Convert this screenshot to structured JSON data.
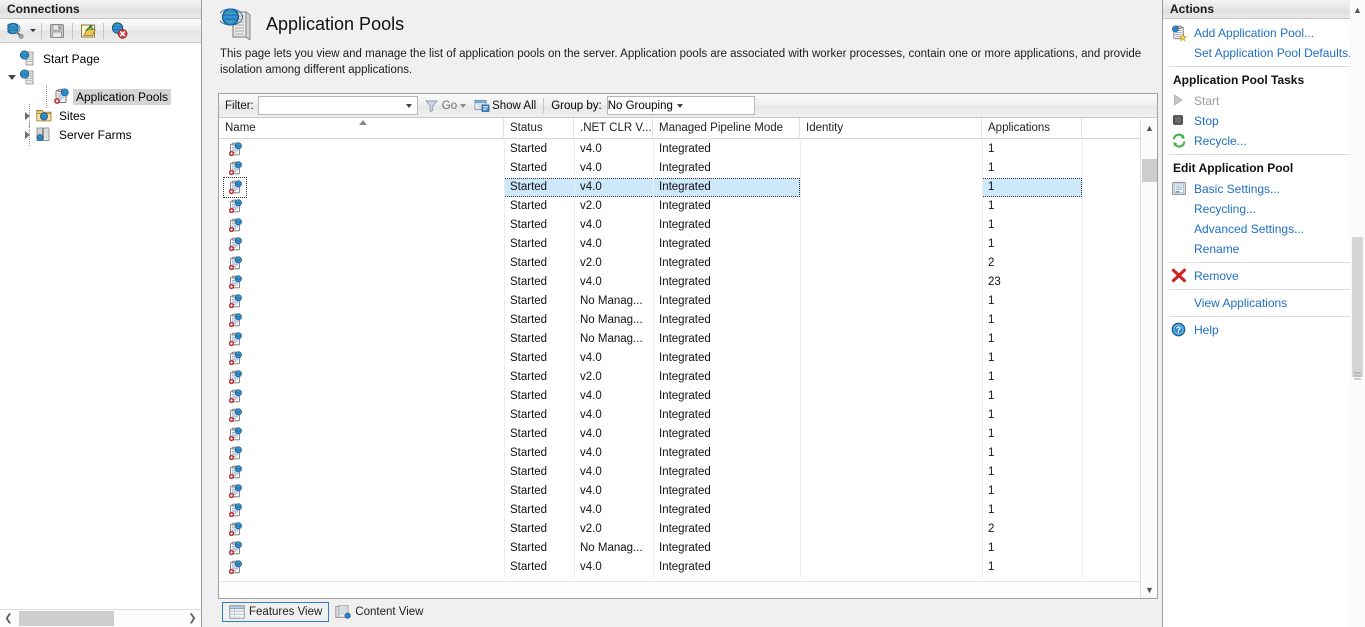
{
  "connections": {
    "title": "Connections",
    "toolbar": [
      {
        "name": "connect-to-button",
        "icon": "globe-connect-icon"
      },
      {
        "name": "save-connections-button",
        "icon": "floppy-disk-icon",
        "disabled": true
      },
      {
        "name": "open-connection-button",
        "icon": "open-folder-icon"
      },
      {
        "name": "disconnect-button",
        "icon": "globe-disconnect-icon"
      }
    ],
    "tree": [
      {
        "label": "Start Page",
        "icon": "start-page-icon",
        "level": 0,
        "expander": "none",
        "selected": false
      },
      {
        "label": "",
        "icon": "server-icon",
        "level": 0,
        "expander": "down",
        "selected": false
      },
      {
        "label": "Application Pools",
        "icon": "application-pools-icon",
        "level": 2,
        "expander": "none",
        "selected": true
      },
      {
        "label": "Sites",
        "icon": "sites-folder-icon",
        "level": 1,
        "expander": "right",
        "selected": false
      },
      {
        "label": "Server Farms",
        "icon": "server-farms-icon",
        "level": 1,
        "expander": "right",
        "selected": false
      }
    ]
  },
  "page": {
    "title": "Application Pools",
    "description": "This page lets you view and manage the list of application pools on the server. Application pools are associated with worker processes, contain one or more applications, and provide isolation among different applications."
  },
  "filter_bar": {
    "filter_label": "Filter:",
    "filter_value": "",
    "go_label": "Go",
    "show_all_label": "Show All",
    "group_by_label": "Group by:",
    "group_by_value": "No Grouping"
  },
  "grid": {
    "columns": [
      {
        "key": "name",
        "label": "Name",
        "sorted": "asc"
      },
      {
        "key": "status",
        "label": "Status"
      },
      {
        "key": "clr",
        "label": ".NET CLR V..."
      },
      {
        "key": "pipeline",
        "label": "Managed Pipeline Mode"
      },
      {
        "key": "identity",
        "label": "Identity"
      },
      {
        "key": "applications",
        "label": "Applications"
      }
    ],
    "rows": [
      {
        "name": "",
        "status": "Started",
        "clr": "v4.0",
        "pipeline": "Integrated",
        "identity": "",
        "applications": "1",
        "selected": false
      },
      {
        "name": "",
        "status": "Started",
        "clr": "v4.0",
        "pipeline": "Integrated",
        "identity": "",
        "applications": "1",
        "selected": false
      },
      {
        "name": "",
        "status": "Started",
        "clr": "v4.0",
        "pipeline": "Integrated",
        "identity": "",
        "applications": "1",
        "selected": true
      },
      {
        "name": "",
        "status": "Started",
        "clr": "v2.0",
        "pipeline": "Integrated",
        "identity": "",
        "applications": "1",
        "selected": false
      },
      {
        "name": "",
        "status": "Started",
        "clr": "v4.0",
        "pipeline": "Integrated",
        "identity": "",
        "applications": "1",
        "selected": false
      },
      {
        "name": "",
        "status": "Started",
        "clr": "v4.0",
        "pipeline": "Integrated",
        "identity": "",
        "applications": "1",
        "selected": false
      },
      {
        "name": "",
        "status": "Started",
        "clr": "v2.0",
        "pipeline": "Integrated",
        "identity": "",
        "applications": "2",
        "selected": false
      },
      {
        "name": "",
        "status": "Started",
        "clr": "v4.0",
        "pipeline": "Integrated",
        "identity": "",
        "applications": "23",
        "selected": false
      },
      {
        "name": "",
        "status": "Started",
        "clr": "No Manag...",
        "pipeline": "Integrated",
        "identity": "",
        "applications": "1",
        "selected": false
      },
      {
        "name": "",
        "status": "Started",
        "clr": "No Manag...",
        "pipeline": "Integrated",
        "identity": "",
        "applications": "1",
        "selected": false
      },
      {
        "name": "",
        "status": "Started",
        "clr": "No Manag...",
        "pipeline": "Integrated",
        "identity": "",
        "applications": "1",
        "selected": false
      },
      {
        "name": "",
        "status": "Started",
        "clr": "v4.0",
        "pipeline": "Integrated",
        "identity": "",
        "applications": "1",
        "selected": false
      },
      {
        "name": "",
        "status": "Started",
        "clr": "v2.0",
        "pipeline": "Integrated",
        "identity": "",
        "applications": "1",
        "selected": false
      },
      {
        "name": "",
        "status": "Started",
        "clr": "v4.0",
        "pipeline": "Integrated",
        "identity": "",
        "applications": "1",
        "selected": false
      },
      {
        "name": "",
        "status": "Started",
        "clr": "v4.0",
        "pipeline": "Integrated",
        "identity": "",
        "applications": "1",
        "selected": false
      },
      {
        "name": "",
        "status": "Started",
        "clr": "v4.0",
        "pipeline": "Integrated",
        "identity": "",
        "applications": "1",
        "selected": false
      },
      {
        "name": "",
        "status": "Started",
        "clr": "v4.0",
        "pipeline": "Integrated",
        "identity": "",
        "applications": "1",
        "selected": false
      },
      {
        "name": "",
        "status": "Started",
        "clr": "v4.0",
        "pipeline": "Integrated",
        "identity": "",
        "applications": "1",
        "selected": false
      },
      {
        "name": "",
        "status": "Started",
        "clr": "v4.0",
        "pipeline": "Integrated",
        "identity": "",
        "applications": "1",
        "selected": false
      },
      {
        "name": "",
        "status": "Started",
        "clr": "v4.0",
        "pipeline": "Integrated",
        "identity": "",
        "applications": "1",
        "selected": false
      },
      {
        "name": "",
        "status": "Started",
        "clr": "v2.0",
        "pipeline": "Integrated",
        "identity": "",
        "applications": "2",
        "selected": false
      },
      {
        "name": "",
        "status": "Started",
        "clr": "No Manag...",
        "pipeline": "Integrated",
        "identity": "",
        "applications": "1",
        "selected": false
      },
      {
        "name": "",
        "status": "Started",
        "clr": "v4.0",
        "pipeline": "Integrated",
        "identity": "",
        "applications": "1",
        "selected": false
      }
    ]
  },
  "view_tabs": [
    {
      "label": "Features View",
      "icon": "features-view-icon",
      "active": true
    },
    {
      "label": "Content View",
      "icon": "content-view-icon",
      "active": false
    }
  ],
  "actions": {
    "title": "Actions",
    "items": [
      {
        "type": "link",
        "label": "Add Application Pool...",
        "icon": "add-application-pool-icon",
        "disabled": false
      },
      {
        "type": "link",
        "label": "Set Application Pool Defaults...",
        "icon": "none",
        "disabled": false
      },
      {
        "type": "separator"
      },
      {
        "type": "header",
        "label": "Application Pool Tasks"
      },
      {
        "type": "link",
        "label": "Start",
        "icon": "play-icon",
        "disabled": true
      },
      {
        "type": "link",
        "label": "Stop",
        "icon": "stop-icon",
        "disabled": false
      },
      {
        "type": "link",
        "label": "Recycle...",
        "icon": "recycle-icon",
        "disabled": false
      },
      {
        "type": "separator"
      },
      {
        "type": "header",
        "label": "Edit Application Pool"
      },
      {
        "type": "link",
        "label": "Basic Settings...",
        "icon": "basic-settings-icon",
        "disabled": false
      },
      {
        "type": "link",
        "label": "Recycling...",
        "icon": "none",
        "disabled": false
      },
      {
        "type": "link",
        "label": "Advanced Settings...",
        "icon": "none",
        "disabled": false
      },
      {
        "type": "link",
        "label": "Rename",
        "icon": "none",
        "disabled": false
      },
      {
        "type": "separator"
      },
      {
        "type": "link",
        "label": "Remove",
        "icon": "remove-x-icon",
        "disabled": false
      },
      {
        "type": "separator"
      },
      {
        "type": "link",
        "label": "View Applications",
        "icon": "none",
        "disabled": false
      },
      {
        "type": "separator"
      },
      {
        "type": "link",
        "label": "Help",
        "icon": "help-icon",
        "disabled": false
      }
    ]
  },
  "colors": {
    "link": "#1f6fc4",
    "selection": "#cde8f9",
    "panel_header_text": "#1a1a1a",
    "disabled_text": "#9c9c9c"
  }
}
